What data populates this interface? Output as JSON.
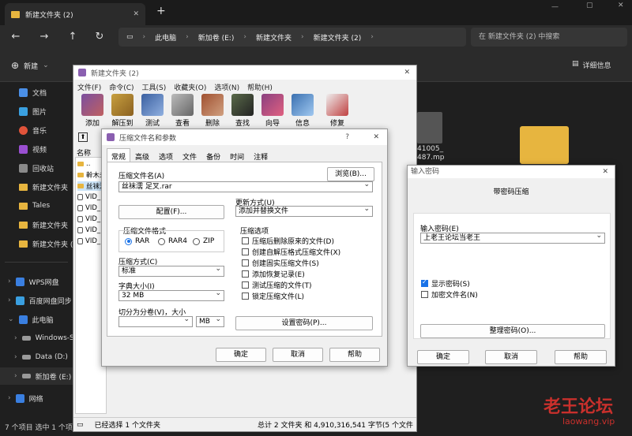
{
  "explorer": {
    "tab_title": "新建文件夹 (2)",
    "breadcrumb": [
      "此电脑",
      "新加卷 (E:)",
      "新建文件夹",
      "新建文件夹 (2)"
    ],
    "search_placeholder": "在 新建文件夹 (2) 中搜索",
    "new_label": "新建",
    "detail_label": "详细信息",
    "sidebar": [
      {
        "label": "文档",
        "icon": "document-icon",
        "color": "#4a8fe7"
      },
      {
        "label": "图片",
        "icon": "picture-icon",
        "color": "#3aa0e0"
      },
      {
        "label": "音乐",
        "icon": "music-icon",
        "color": "#e0533a"
      },
      {
        "label": "视频",
        "icon": "video-icon",
        "color": "#9a4fd1"
      },
      {
        "label": "回收站",
        "icon": "recycle-bin-icon",
        "color": "#8a8a8a"
      },
      {
        "label": "新建文件夹",
        "icon": "folder-icon",
        "color": "#e7b53f"
      },
      {
        "label": "Tales",
        "icon": "folder-icon",
        "color": "#e7b53f"
      },
      {
        "label": "新建文件夹",
        "icon": "folder-icon",
        "color": "#e7b53f"
      },
      {
        "label": "新建文件夹 (",
        "icon": "folder-icon",
        "color": "#e7b53f"
      }
    ],
    "sidebar_tree": [
      {
        "label": "WPS网盘",
        "icon": "cloud-icon",
        "color": "#3a7fe0"
      },
      {
        "label": "百度网盘同步",
        "icon": "cloud-icon",
        "color": "#3a9fe0"
      },
      {
        "label": "此电脑",
        "icon": "computer-icon",
        "color": "#3a7fe0"
      },
      {
        "label": "Windows-S",
        "icon": "drive-icon",
        "color": "#9a9a9a"
      },
      {
        "label": "Data (D:)",
        "icon": "drive-icon",
        "color": "#9a9a9a"
      },
      {
        "label": "新加卷 (E:)",
        "icon": "drive-icon",
        "color": "#9a9a9a"
      },
      {
        "label": "网络",
        "icon": "network-icon",
        "color": "#3a7fe0"
      }
    ],
    "status": "7 个项目  选中 1 个项目",
    "file_tile_label": "41005_\n487.mp"
  },
  "rar": {
    "title": "新建文件夹 (2)",
    "menu": [
      "文件(F)",
      "命令(C)",
      "工具(S)",
      "收藏夹(O)",
      "选项(N)",
      "帮助(H)"
    ],
    "tools": [
      {
        "label": "添加",
        "color": "#7a4fa0"
      },
      {
        "label": "解压到",
        "color": "#c8a040"
      },
      {
        "label": "测试",
        "color": "#3a5fa0"
      },
      {
        "label": "查看",
        "color": "#7a7a7a"
      },
      {
        "label": "删除",
        "color": "#a05030"
      },
      {
        "label": "查找",
        "color": "#5a6a4a"
      },
      {
        "label": "向导",
        "color": "#8a4080"
      },
      {
        "label": "信息",
        "color": "#3a70b0"
      },
      {
        "label": "修复",
        "color": "#c04040"
      }
    ],
    "list_header": "名称",
    "list": [
      "..",
      "幹木未",
      "丝袜涅",
      "VID_",
      "VID_",
      "VID_",
      "VID_",
      "VID_"
    ],
    "status_left": "已经选择 1 个文件夹",
    "status_right": "总计 2 文件夹 和 4,910,316,541 字节(5 个文件"
  },
  "compress": {
    "title": "压缩文件名和参数",
    "help_mark": "?",
    "tabs": [
      "常规",
      "高级",
      "选项",
      "文件",
      "备份",
      "时间",
      "注释"
    ],
    "archive_name_label": "压缩文件名(A)",
    "browse": "浏览(B)...",
    "archive_name": "丝袜濡 足叉.rar",
    "update_mode_label": "更新方式(U)",
    "update_mode": "添加并替换文件",
    "profile_button": "配置(F)...",
    "format_label": "压缩文件格式",
    "formats": [
      "RAR",
      "RAR4",
      "ZIP"
    ],
    "method_label": "压缩方式(C)",
    "method": "标准",
    "dict_label": "字典大小(I)",
    "dict": "32 MB",
    "split_label": "切分为分卷(V)，大小",
    "split_unit": "MB",
    "options_label": "压缩选项",
    "options": [
      "压缩后删除原来的文件(D)",
      "创建自解压格式压缩文件(X)",
      "创建固实压缩文件(S)",
      "添加恢复记录(E)",
      "测试压缩的文件(T)",
      "锁定压缩文件(L)"
    ],
    "set_password": "设置密码(P)...",
    "ok": "确定",
    "cancel": "取消",
    "help": "帮助"
  },
  "password": {
    "title": "输入密码",
    "heading": "带密码压缩",
    "label": "输入密码(E)",
    "value": "上老王论坛当老王",
    "show_password": "显示密码(S)",
    "encrypt_names": "加密文件名(N)",
    "organize": "整理密码(O)...",
    "ok": "确定",
    "cancel": "取消",
    "help": "帮助"
  },
  "watermark": {
    "brand": "老王论坛",
    "url": "laowang.vip"
  }
}
